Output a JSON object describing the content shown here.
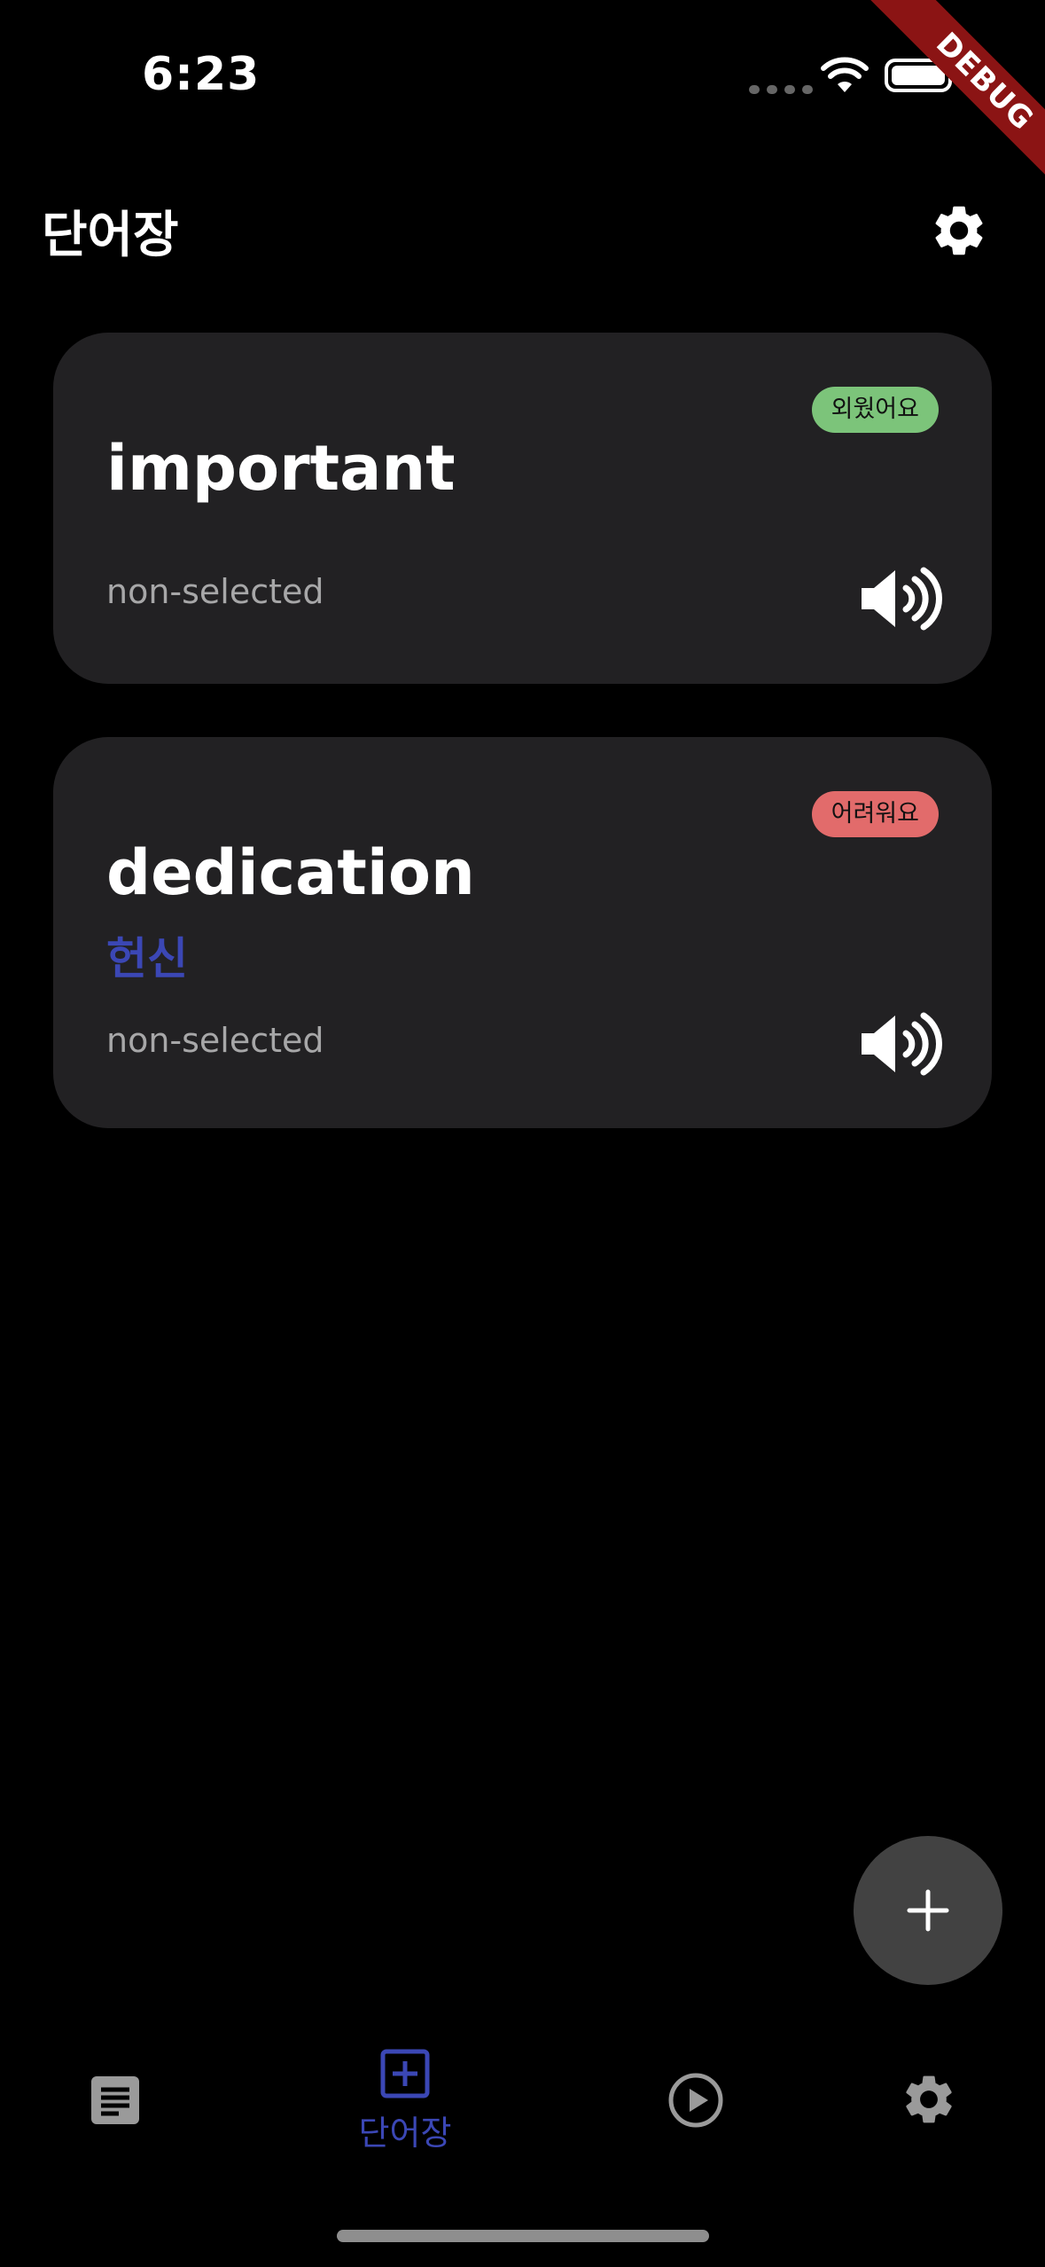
{
  "status_bar": {
    "time": "6:23"
  },
  "debug_banner": "DEBUG",
  "header": {
    "title": "단어장"
  },
  "cards": [
    {
      "badge": "외웠어요",
      "badge_color": "#7cc47a",
      "word": "important",
      "meaning": "",
      "status": "non-selected"
    },
    {
      "badge": "어려워요",
      "badge_color": "#e26b6b",
      "word": "dedication",
      "meaning": "헌신",
      "status": "non-selected"
    }
  ],
  "fab": {
    "icon": "plus-icon"
  },
  "bottom_nav": {
    "items": [
      {
        "icon": "article-icon",
        "label": ""
      },
      {
        "icon": "add-box-icon",
        "label": "단어장",
        "active": true
      },
      {
        "icon": "play-circle-icon",
        "label": ""
      },
      {
        "icon": "settings-icon",
        "label": ""
      }
    ]
  },
  "colors": {
    "background": "#000000",
    "card": "#222123",
    "accent": "#3b47b5",
    "fab": "#424242"
  }
}
